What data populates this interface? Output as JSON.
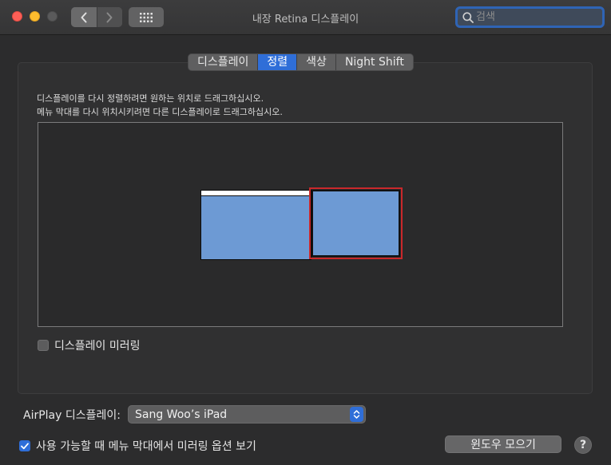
{
  "window": {
    "title": "내장 Retina 디스플레이"
  },
  "search": {
    "placeholder": "검색",
    "value": ""
  },
  "tabs": [
    {
      "label": "디스플레이",
      "active": false
    },
    {
      "label": "정렬",
      "active": true
    },
    {
      "label": "색상",
      "active": false
    },
    {
      "label": "Night Shift",
      "active": false
    }
  ],
  "arrangement": {
    "instruction_line1": "디스플레이를 다시 정렬하려면 원하는 위치로 드래그하십시오.",
    "instruction_line2": "메뉴 막대를 다시 위치시키려면 다른 디스플레이로 드래그하십시오."
  },
  "mirror": {
    "label": "디스플레이 미러링",
    "checked": false
  },
  "airplay": {
    "label": "AirPlay 디스플레이:",
    "selected": "Sang Woo’s iPad"
  },
  "show_mirroring": {
    "label": "사용 가능할 때 메뉴 막대에서 미러링 옵션 보기",
    "checked": true
  },
  "buttons": {
    "gather_windows": "윈도우 모으기",
    "help": "?"
  },
  "colors": {
    "accent": "#2f6ed8",
    "display_fill": "#6d9ad4",
    "selection": "#c9282b"
  }
}
